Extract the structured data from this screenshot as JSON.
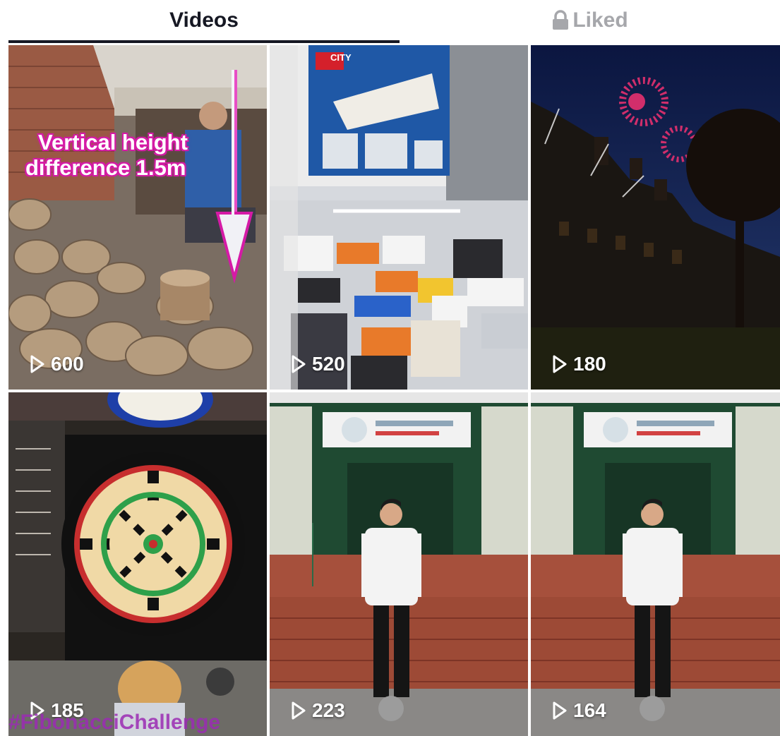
{
  "tabs": {
    "videos_label": "Videos",
    "liked_label": "Liked",
    "liked_icon": "lock-icon",
    "active_tab": "Videos"
  },
  "videos": [
    {
      "views": "600",
      "overlay_line1": "Vertical height",
      "overlay_line2": "difference 1.5m"
    },
    {
      "views": "520",
      "box_label": "CITY"
    },
    {
      "views": "180"
    },
    {
      "views": "185",
      "hashtag": "#FibonacciChallenge"
    },
    {
      "views": "223"
    },
    {
      "views": "164"
    }
  ],
  "colors": {
    "text_primary": "#161823",
    "text_inactive": "#a6a7ab",
    "overlay_magenta": "#d51aa6"
  }
}
